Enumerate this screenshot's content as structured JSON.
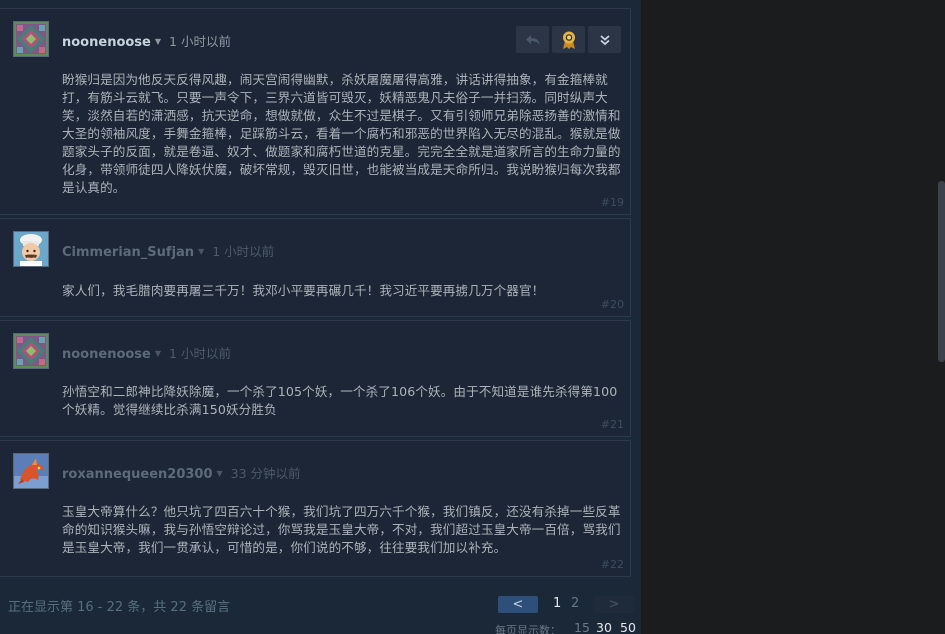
{
  "comments": [
    {
      "author": "noonenoose",
      "time": "1 小时以前",
      "text": "盼猴归是因为他反天反得风趣，闹天宫闹得幽默，杀妖屠魔屠得高雅，讲话讲得抽象，有金箍棒就打，有筋斗云就飞。只要一声令下，三界六道皆可毁灭，妖精恶鬼凡夫俗子一并扫荡。同时纵声大笑，淡然自若的潇洒感，抗天逆命，想做就做，众生不过是棋子。又有引领师兄弟除恶扬善的激情和大圣的领袖风度，手舞金箍棒，足踩筋斗云，看着一个腐朽和邪恶的世界陷入无尽的混乱。猴就是做题家头子的反面，就是卷逼、奴才、做题家和腐朽世道的克星。完完全全就是道家所言的生命力量的化身，带领师徒四人降妖伏魔，破坏常规，毁灭旧世，也能被当成是天命所归。我说盼猴归每次我都是认真的。",
      "index": "#19"
    },
    {
      "author": "Cimmerian_Sufjan",
      "time": "1 小时以前",
      "text": "家人们，我毛腊肉要再屠三千万！我邓小平要再碾几千！我习近平要再掳几万个器官！",
      "index": "#20"
    },
    {
      "author": "noonenoose",
      "time": "1 小时以前",
      "text": "孙悟空和二郎神比降妖除魔，一个杀了105个妖，一个杀了106个妖。由于不知道是谁先杀得第100个妖精。觉得继续比杀满150妖分胜负",
      "index": "#21"
    },
    {
      "author": "roxannequeen20300",
      "time": "33 分钟以前",
      "text": "玉皇大帝算什么？他只坑了四百六十个猴，我们坑了四万六千个猴，我们镇反，还没有杀掉一些反革命的知识猴头嘛，我与孙悟空辩论过，你骂我是玉皇大帝，不对，我们超过玉皇大帝一百倍，骂我们是玉皇大帝，我们一贯承认，可惜的是，你们说的不够，往往要我们加以补充。",
      "index": "#22"
    }
  ],
  "actions": {
    "reply_icon": "reply-icon",
    "award_icon": "award-icon",
    "more_icon": "chevron-double-down-icon"
  },
  "pagination": {
    "info": "正在显示第 16 - 22 条，共 22 条留言",
    "prev": "<",
    "next": ">",
    "pages": [
      "1",
      "2"
    ],
    "current_page": "1",
    "per_page_label": "每页显示数：",
    "per_page_options": [
      "15",
      "30",
      "50"
    ]
  },
  "colors": {
    "background": "#1b2838",
    "comment_bg": "#1c2636",
    "accent_button": "#2d4f79",
    "award_gold": "#e6b640"
  }
}
